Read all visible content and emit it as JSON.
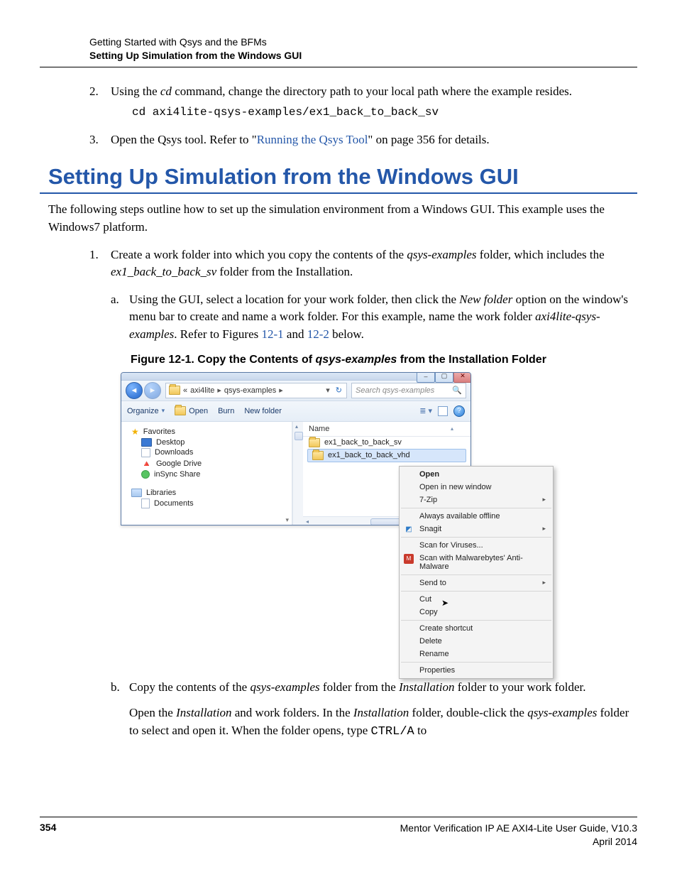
{
  "header": {
    "line1": "Getting Started with Qsys and the BFMs",
    "line2": "Setting Up Simulation from the Windows GUI"
  },
  "step2": {
    "p1a": "Using the ",
    "cmd": "cd",
    "p1b": " command, change the directory path to your local path where the example resides.",
    "code": "cd axi4lite-qsys-examples/ex1_back_to_back_sv"
  },
  "step3": {
    "p_a": "Open the Qsys tool. Refer to \"",
    "link": "Running the Qsys Tool",
    "p_b": "\" on page 356 for details."
  },
  "section_heading": "Setting Up Simulation from the Windows GUI",
  "intro": "The following steps outline how to set up the simulation environment from a Windows GUI. This example uses the Windows7 platform.",
  "s1": {
    "p_a": "Create a work folder into which you copy the contents of the ",
    "ital1": "qsys-examples",
    "p_b": " folder, which includes the ",
    "ital2": "ex1_back_to_back_sv",
    "p_c": " folder from the Installation."
  },
  "s1a": {
    "t1": "Using the GUI, select a location for your work folder, then click the ",
    "ital1": "New folder",
    "t2": " option on the window's menu bar to create and name a work folder. For this example, name the work folder ",
    "ital2": "axi4lite-qsys-examples",
    "t3": ". Refer to Figures ",
    "link1": "12-1",
    "t4": " and ",
    "link2": "12-2",
    "t5": " below."
  },
  "figcap": {
    "pre": "Figure 12-1. Copy the Contents of ",
    "ital": "qsys-examples",
    "post": " from the Installation Folder"
  },
  "explorer": {
    "breadcrumb": {
      "seg0": "«",
      "seg1": "axi4lite",
      "seg2": "qsys-examples"
    },
    "search_placeholder": "Search qsys-examples",
    "toolbar": {
      "organize": "Organize",
      "open": "Open",
      "burn": "Burn",
      "newfolder": "New folder"
    },
    "nav": {
      "favorites": "Favorites",
      "desktop": "Desktop",
      "downloads": "Downloads",
      "gdrive": "Google Drive",
      "insync": "inSync Share",
      "libraries": "Libraries",
      "documents": "Documents"
    },
    "col_name": "Name",
    "files": {
      "f1": "ex1_back_to_back_sv",
      "f2": "ex1_back_to_back_vhd"
    }
  },
  "context_menu": {
    "open": "Open",
    "open_new": "Open in new window",
    "sevenzip": "7-Zip",
    "offline": "Always available offline",
    "snagit": "Snagit",
    "scan_virus": "Scan for Viruses...",
    "scan_mbam": "Scan with Malwarebytes' Anti-Malware",
    "sendto": "Send to",
    "cut": "Cut",
    "copy": "Copy",
    "shortcut": "Create shortcut",
    "delete": "Delete",
    "rename": "Rename",
    "properties": "Properties"
  },
  "s1b": {
    "p1a": "Copy the contents of the ",
    "ital1": "qsys-examples",
    "p1b": " folder from the ",
    "ital2": "Installation",
    "p1c": " folder to your work folder.",
    "p2a": "Open the ",
    "ital3": "Installation",
    "p2b": " and work folders. In the ",
    "ital4": "Installation",
    "p2c": " folder, double-click the ",
    "ital5": "qsys-examples",
    "p2d": " folder to select and open it. When the folder opens, type ",
    "mono": "CTRL/A",
    "p2e": " to"
  },
  "footer": {
    "page": "354",
    "title": "Mentor Verification IP AE AXI4-Lite User Guide, V10.3",
    "date": "April 2014"
  }
}
